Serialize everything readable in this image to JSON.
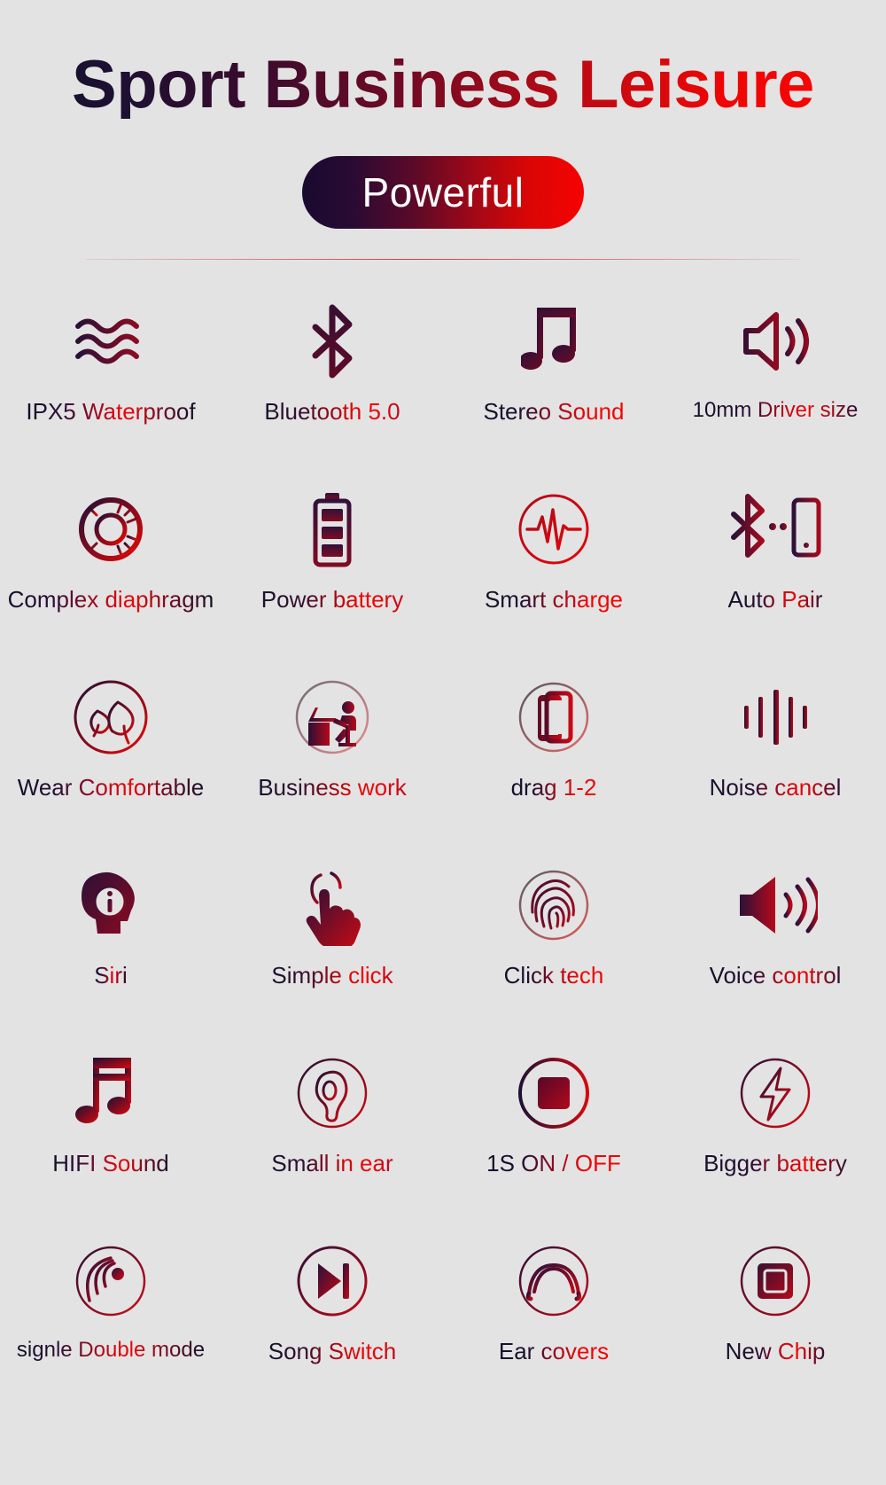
{
  "header": {
    "title": "Sport Business Leisure",
    "badge_label": "Powerful",
    "title_gradient_start": "#14122b",
    "title_gradient_end": "#fb0303",
    "badge_gradient_start": "#190a30",
    "badge_gradient_end": "#f70202",
    "background_color": "#e3e3e3"
  },
  "features": [
    {
      "icon": "water-waves-icon",
      "label": "IPX5 Waterproof"
    },
    {
      "icon": "bluetooth-icon",
      "label": "Bluetooth 5.0"
    },
    {
      "icon": "music-note-icon",
      "label": "Stereo Sound"
    },
    {
      "icon": "speaker-wave-icon",
      "label": "10mm Driver size"
    },
    {
      "icon": "diaphragm-spiral-icon",
      "label": "Complex diaphragm"
    },
    {
      "icon": "battery-icon",
      "label": "Power battery"
    },
    {
      "icon": "pulse-circle-icon",
      "label": "Smart charge"
    },
    {
      "icon": "bluetooth-phone-icon",
      "label": "Auto Pair"
    },
    {
      "icon": "leaves-circle-icon",
      "label": "Wear Comfortable"
    },
    {
      "icon": "desk-worker-icon",
      "label": "Business work"
    },
    {
      "icon": "two-phones-icon",
      "label": "drag 1-2"
    },
    {
      "icon": "sound-bars-icon",
      "label": "Noise cancel"
    },
    {
      "icon": "head-info-icon",
      "label": "Siri"
    },
    {
      "icon": "tap-hand-icon",
      "label": "Simple click"
    },
    {
      "icon": "fingerprint-icon",
      "label": "Click tech"
    },
    {
      "icon": "megaphone-icon",
      "label": "Voice control"
    },
    {
      "icon": "beamed-notes-icon",
      "label": "HIFI Sound"
    },
    {
      "icon": "ear-circle-icon",
      "label": "Small in ear"
    },
    {
      "icon": "stop-square-icon",
      "label": "1S ON / OFF"
    },
    {
      "icon": "lightning-circle-icon",
      "label": "Bigger battery"
    },
    {
      "icon": "signal-waves-icon",
      "label": "signle Double mode"
    },
    {
      "icon": "next-track-icon",
      "label": "Song Switch"
    },
    {
      "icon": "headband-icon",
      "label": "Ear covers"
    },
    {
      "icon": "chip-icon",
      "label": "New Chip"
    }
  ]
}
